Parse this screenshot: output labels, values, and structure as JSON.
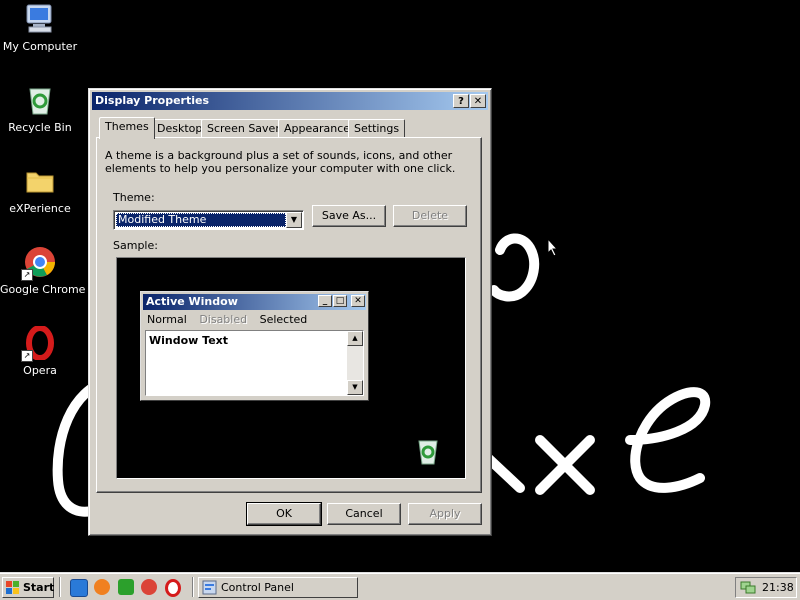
{
  "desktop": {
    "icons": [
      {
        "label": "My Computer",
        "icon": "computer-icon"
      },
      {
        "label": "Recycle Bin",
        "icon": "recycle-bin-icon"
      },
      {
        "label": "eXPerience",
        "icon": "folder-icon"
      },
      {
        "label": "Google Chrome",
        "icon": "chrome-icon"
      },
      {
        "label": "Opera",
        "icon": "opera-icon"
      }
    ]
  },
  "dialog": {
    "title": "Display Properties",
    "help_button": "?",
    "close_button": "✕",
    "tabs": [
      "Themes",
      "Desktop",
      "Screen Saver",
      "Appearance",
      "Settings"
    ],
    "active_tab": "Themes",
    "description": "A theme is a background plus a set of sounds, icons, and other elements to help you personalize your computer with one click.",
    "theme_label": "Theme:",
    "theme_value": "Modified Theme",
    "save_as_label": "Save As...",
    "delete_label": "Delete",
    "sample_label": "Sample:",
    "ok_label": "OK",
    "cancel_label": "Cancel",
    "apply_label": "Apply"
  },
  "preview": {
    "title": "Active Window",
    "menu_normal": "Normal",
    "menu_disabled": "Disabled",
    "menu_selected": "Selected",
    "window_text": "Window Text"
  },
  "taskbar": {
    "start_label": "Start",
    "quick_launch": [
      "ie-icon",
      "firefox-icon",
      "show-desktop-icon",
      "chrome-icon",
      "opera-icon"
    ],
    "task_item": "Control Panel",
    "clock": "21:38"
  },
  "colors": {
    "title_active": "#0a246a",
    "title_gradient_end": "#a6caf0",
    "face": "#d4d0c8",
    "desktop": "#000000"
  }
}
